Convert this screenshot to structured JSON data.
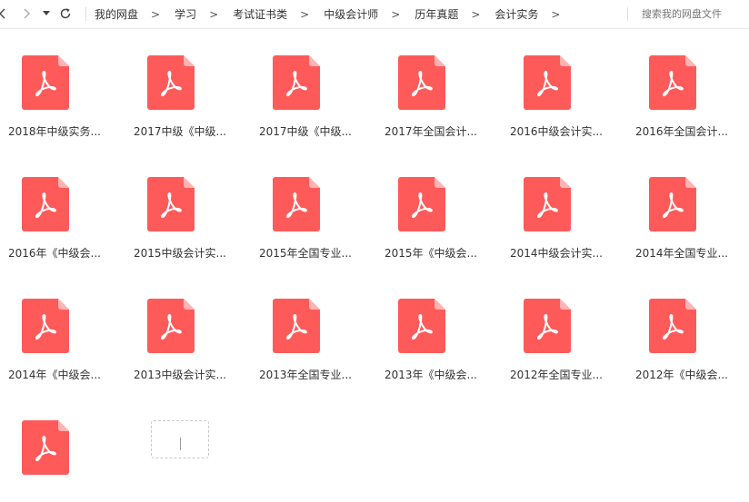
{
  "toolbar": {
    "back_icon": "chevron-left-icon",
    "forward_icon": "chevron-right-icon",
    "history_icon": "caret-down-icon",
    "refresh_icon": "refresh-icon",
    "breadcrumb": [
      "我的网盘",
      "学习",
      "考试证书类",
      "中级会计师",
      "历年真题",
      "会计实务"
    ],
    "search_placeholder": "搜索我的网盘文件"
  },
  "files": [
    {
      "name": "2018年中级实务...",
      "type": "pdf"
    },
    {
      "name": "2017中级《中级...",
      "type": "pdf"
    },
    {
      "name": "2017中级《中级...",
      "type": "pdf"
    },
    {
      "name": "2017年全国会计...",
      "type": "pdf"
    },
    {
      "name": "2016中级会计实...",
      "type": "pdf"
    },
    {
      "name": "2016年全国会计...",
      "type": "pdf"
    },
    {
      "name": "2016年《中级会...",
      "type": "pdf"
    },
    {
      "name": "2015中级会计实...",
      "type": "pdf"
    },
    {
      "name": "2015年全国专业...",
      "type": "pdf"
    },
    {
      "name": "2015年《中级会...",
      "type": "pdf"
    },
    {
      "name": "2014中级会计实...",
      "type": "pdf"
    },
    {
      "name": "2014年全国专业...",
      "type": "pdf"
    },
    {
      "name": "2014年《中级会...",
      "type": "pdf"
    },
    {
      "name": "2013中级会计实...",
      "type": "pdf"
    },
    {
      "name": "2013年全国专业...",
      "type": "pdf"
    },
    {
      "name": "2013年《中级会...",
      "type": "pdf"
    },
    {
      "name": "2012年全国专业...",
      "type": "pdf"
    },
    {
      "name": "2012年《中级会...",
      "type": "pdf"
    },
    {
      "name": "",
      "type": "pdf"
    }
  ],
  "colors": {
    "pdf_icon": "#ff5a5a",
    "pdf_fold": "#ffb3b3"
  }
}
